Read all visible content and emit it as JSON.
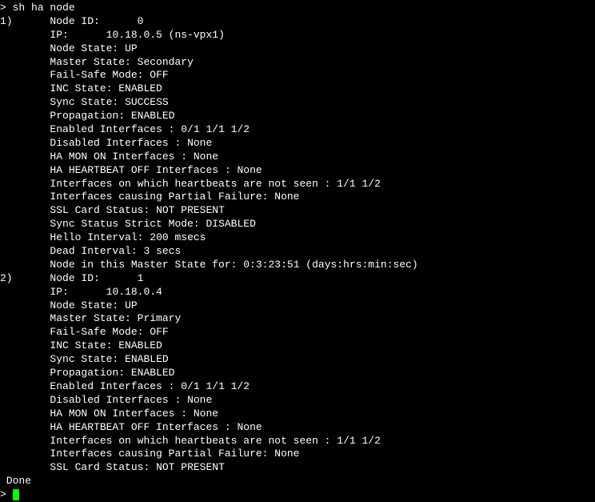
{
  "prompt": ">",
  "command": "sh ha node",
  "node1": {
    "index": "1)",
    "node_id_label": "Node ID:",
    "node_id": "0",
    "ip_label": "IP:",
    "ip": "10.18.0.5 (ns-vpx1)",
    "node_state_label": "Node State:",
    "node_state": "UP",
    "master_state_label": "Master State:",
    "master_state": "Secondary",
    "failsafe_label": "Fail-Safe Mode:",
    "failsafe": "OFF",
    "inc_state_label": "INC State:",
    "inc_state": "ENABLED",
    "sync_state_label": "Sync State:",
    "sync_state": "SUCCESS",
    "propagation_label": "Propagation:",
    "propagation": "ENABLED",
    "enabled_if_label": "Enabled Interfaces :",
    "enabled_if": "0/1 1/1 1/2",
    "disabled_if_label": "Disabled Interfaces :",
    "disabled_if": "None",
    "hamon_label": "HA MON ON Interfaces :",
    "hamon": "None",
    "heartbeat_off_label": "HA HEARTBEAT OFF Interfaces :",
    "heartbeat_off": "None",
    "heartbeat_not_seen_label": "Interfaces on which heartbeats are not seen :",
    "heartbeat_not_seen": "1/1 1/2",
    "partial_failure_label": "Interfaces causing Partial Failure:",
    "partial_failure": "None",
    "ssl_label": "SSL Card Status:",
    "ssl": "NOT PRESENT",
    "sync_strict_label": "Sync Status Strict Mode:",
    "sync_strict": "DISABLED",
    "hello_label": "Hello Interval:",
    "hello": "200 msecs",
    "dead_label": "Dead Interval:",
    "dead": "3 secs",
    "uptime_label": "Node in this Master State for:",
    "uptime": "0:3:23:51 (days:hrs:min:sec)"
  },
  "node2": {
    "index": "2)",
    "node_id_label": "Node ID:",
    "node_id": "1",
    "ip_label": "IP:",
    "ip": "10.18.0.4",
    "node_state_label": "Node State:",
    "node_state": "UP",
    "master_state_label": "Master State:",
    "master_state": "Primary",
    "failsafe_label": "Fail-Safe Mode:",
    "failsafe": "OFF",
    "inc_state_label": "INC State:",
    "inc_state": "ENABLED",
    "sync_state_label": "Sync State:",
    "sync_state": "ENABLED",
    "propagation_label": "Propagation:",
    "propagation": "ENABLED",
    "enabled_if_label": "Enabled Interfaces :",
    "enabled_if": "0/1 1/1 1/2",
    "disabled_if_label": "Disabled Interfaces :",
    "disabled_if": "None",
    "hamon_label": "HA MON ON Interfaces :",
    "hamon": "None",
    "heartbeat_off_label": "HA HEARTBEAT OFF Interfaces :",
    "heartbeat_off": "None",
    "heartbeat_not_seen_label": "Interfaces on which heartbeats are not seen :",
    "heartbeat_not_seen": "1/1 1/2",
    "partial_failure_label": "Interfaces causing Partial Failure:",
    "partial_failure": "None",
    "ssl_label": "SSL Card Status:",
    "ssl": "NOT PRESENT"
  },
  "done": " Done",
  "final_prompt": ">"
}
